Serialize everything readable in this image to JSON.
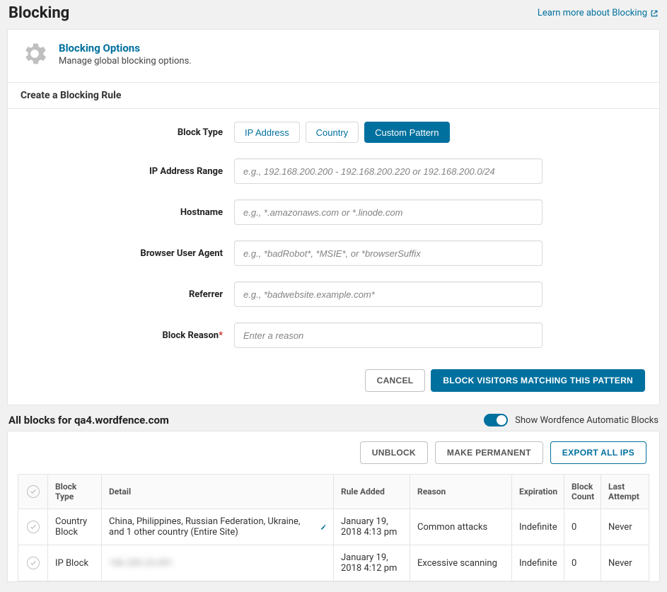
{
  "header": {
    "title": "Blocking",
    "learn_more": "Learn more about Blocking"
  },
  "options": {
    "title": "Blocking Options",
    "subtitle": "Manage global blocking options."
  },
  "create_rule_heading": "Create a Blocking Rule",
  "form": {
    "block_type_label": "Block Type",
    "tabs": {
      "ip": "IP Address",
      "country": "Country",
      "custom": "Custom Pattern"
    },
    "ip_range_label": "IP Address Range",
    "ip_range_ph": "e.g., 192.168.200.200 - 192.168.200.220 or 192.168.200.0/24",
    "hostname_label": "Hostname",
    "hostname_ph": "e.g., *.amazonaws.com or *.linode.com",
    "ua_label": "Browser User Agent",
    "ua_ph": "e.g., *badRobot*, *MSIE*, or *browserSuffix",
    "referrer_label": "Referrer",
    "referrer_ph": "e.g., *badwebsite.example.com*",
    "reason_label": "Block Reason",
    "reason_ph": "Enter a reason"
  },
  "buttons": {
    "cancel": "CANCEL",
    "block_pattern": "BLOCK VISITORS MATCHING THIS PATTERN",
    "unblock": "UNBLOCK",
    "make_permanent": "MAKE PERMANENT",
    "export_ips": "EXPORT ALL IPS"
  },
  "blocks": {
    "heading_prefix": "All blocks for ",
    "site": "qa4.wordfence.com",
    "toggle_label": "Show Wordfence Automatic Blocks"
  },
  "table": {
    "headers": {
      "type": "Block Type",
      "detail": "Detail",
      "added": "Rule Added",
      "reason": "Reason",
      "expiration": "Expiration",
      "count": "Block Count",
      "last": "Last Attempt"
    },
    "rows": [
      {
        "type": "Country Block",
        "detail": "China, Philippines, Russian Federation, Ukraine, and 1 other country (Entire Site)",
        "added": "January 19, 2018 4:13 pm",
        "reason": "Common attacks",
        "expiration": "Indefinite",
        "count": "0",
        "last": "Never",
        "editable": true
      },
      {
        "type": "IP Block",
        "detail_blur": "186.200.23.091",
        "added": "January 19, 2018 4:12 pm",
        "reason": "Excessive scanning",
        "expiration": "Indefinite",
        "count": "0",
        "last": "Never"
      }
    ]
  }
}
